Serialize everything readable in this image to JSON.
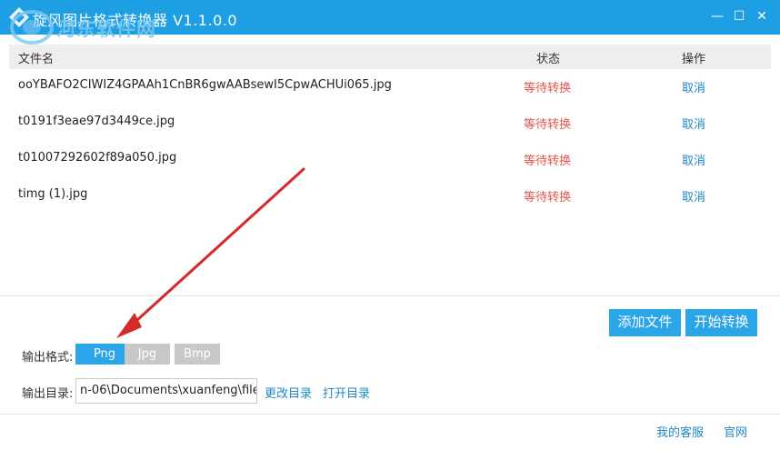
{
  "window": {
    "title": "旋风图片格式转换器 V1.1.0.0",
    "minimize_glyph": "—",
    "maximize_glyph": "☐",
    "close_glyph": "✕"
  },
  "watermark": {
    "line1": "河东软件网",
    "line2": "www.pc0359.cn"
  },
  "list": {
    "headers": {
      "name": "文件名",
      "status": "状态",
      "action": "操作"
    },
    "rows": [
      {
        "name": "ooYBAFO2CIWIZ4GPAAh1CnBR6gwAABsewI5CpwACHUi065.jpg",
        "status": "等待转换",
        "action": "取消"
      },
      {
        "name": "t0191f3eae97d3449ce.jpg",
        "status": "等待转换",
        "action": "取消"
      },
      {
        "name": "t01007292602f89a050.jpg",
        "status": "等待转换",
        "action": "取消"
      },
      {
        "name": "timg (1).jpg",
        "status": "等待转换",
        "action": "取消"
      }
    ]
  },
  "buttons": {
    "add_file": "添加文件",
    "start_convert": "开始转换"
  },
  "output": {
    "format_label": "输出格式:",
    "formats": [
      "Png",
      "Jpg",
      "Bmp"
    ],
    "selected_format": "Png",
    "dir_label": "输出目录:",
    "dir_value": "n-06\\Documents\\xuanfeng\\file",
    "change_dir": "更改目录",
    "open_dir": "打开目录"
  },
  "footer": {
    "service": "我的客服",
    "website": "官网"
  },
  "colors": {
    "accent": "#2aa5e8",
    "titlebar": "#1e9fe4",
    "status": "#e2564c",
    "link": "#1e88c8",
    "inactive": "#c8c8c8",
    "annotation_arrow": "#d32a2a"
  }
}
